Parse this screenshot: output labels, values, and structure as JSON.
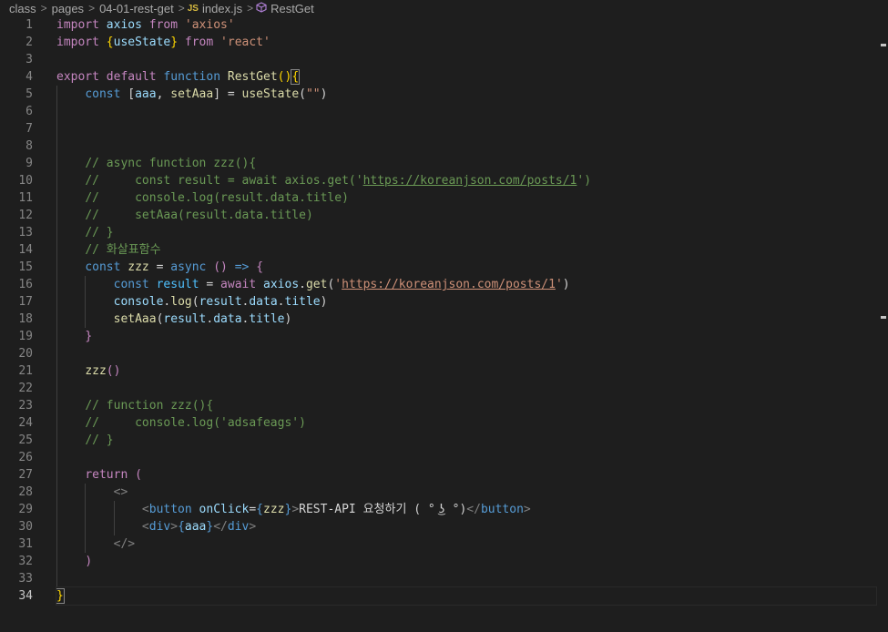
{
  "breadcrumb": {
    "items": [
      "class",
      "pages",
      "04-01-rest-get"
    ],
    "file_badge": "JS",
    "file_name": "index.js",
    "symbol": "RestGet"
  },
  "editor": {
    "current_line": 34,
    "line_numbers": [
      "1",
      "2",
      "3",
      "4",
      "5",
      "6",
      "7",
      "8",
      "9",
      "10",
      "11",
      "12",
      "13",
      "14",
      "15",
      "16",
      "17",
      "18",
      "19",
      "20",
      "21",
      "22",
      "23",
      "24",
      "25",
      "26",
      "27",
      "28",
      "29",
      "30",
      "31",
      "32",
      "33",
      "34"
    ],
    "lines": [
      [
        [
          "kw-ctl",
          "import"
        ],
        [
          "p",
          " "
        ],
        [
          "var",
          "axios"
        ],
        [
          "p",
          " "
        ],
        [
          "ctl",
          "from"
        ],
        [
          "p",
          " "
        ],
        [
          "str",
          "'axios'"
        ]
      ],
      [
        [
          "ctl",
          "import"
        ],
        [
          "p",
          " "
        ],
        [
          "brk",
          "{"
        ],
        [
          "var",
          "useState"
        ],
        [
          "brk",
          "}"
        ],
        [
          "p",
          " "
        ],
        [
          "ctl",
          "from"
        ],
        [
          "p",
          " "
        ],
        [
          "str",
          "'react'"
        ]
      ],
      [],
      [
        [
          "ctl",
          "export"
        ],
        [
          "p",
          " "
        ],
        [
          "ctl",
          "default"
        ],
        [
          "p",
          " "
        ],
        [
          "kw",
          "function"
        ],
        [
          "p",
          " "
        ],
        [
          "fn",
          "RestGet"
        ],
        [
          "brk",
          "()"
        ],
        [
          "brkhl",
          "{"
        ]
      ],
      [
        [
          "p",
          "    "
        ],
        [
          "kw",
          "const"
        ],
        [
          "p",
          " "
        ],
        [
          "plain",
          "["
        ],
        [
          "var",
          "aaa"
        ],
        [
          "plain",
          ", "
        ],
        [
          "fn",
          "setAaa"
        ],
        [
          "plain",
          "]"
        ],
        [
          "p",
          " = "
        ],
        [
          "fn",
          "useState"
        ],
        [
          "plain",
          "("
        ],
        [
          "str",
          "\"\""
        ],
        [
          "plain",
          ")"
        ]
      ],
      [],
      [],
      [],
      [
        [
          "p",
          "    "
        ],
        [
          "cm",
          "// async function zzz(){"
        ]
      ],
      [
        [
          "p",
          "    "
        ],
        [
          "cm",
          "//     const result = await axios.get('"
        ],
        [
          "cmurl",
          "https://koreanjson.com/posts/1"
        ],
        [
          "cm",
          "')"
        ]
      ],
      [
        [
          "p",
          "    "
        ],
        [
          "cm",
          "//     console.log(result.data.title)"
        ]
      ],
      [
        [
          "p",
          "    "
        ],
        [
          "cm",
          "//     setAaa(result.data.title)"
        ]
      ],
      [
        [
          "p",
          "    "
        ],
        [
          "cm",
          "// }"
        ]
      ],
      [
        [
          "p",
          "    "
        ],
        [
          "cm",
          "// 화살표함수"
        ]
      ],
      [
        [
          "p",
          "    "
        ],
        [
          "kw",
          "const"
        ],
        [
          "p",
          " "
        ],
        [
          "fn",
          "zzz"
        ],
        [
          "p",
          " = "
        ],
        [
          "kw",
          "async"
        ],
        [
          "p",
          " "
        ],
        [
          "ctl",
          "()"
        ],
        [
          "p",
          " "
        ],
        [
          "kw",
          "=>"
        ],
        [
          "p",
          " "
        ],
        [
          "ctl",
          "{"
        ]
      ],
      [
        [
          "p",
          "        "
        ],
        [
          "kw",
          "const"
        ],
        [
          "p",
          " "
        ],
        [
          "const",
          "result"
        ],
        [
          "p",
          " = "
        ],
        [
          "ctl",
          "await"
        ],
        [
          "p",
          " "
        ],
        [
          "var",
          "axios"
        ],
        [
          "plain",
          "."
        ],
        [
          "fn",
          "get"
        ],
        [
          "plain",
          "("
        ],
        [
          "str",
          "'"
        ],
        [
          "url",
          "https://koreanjson.com/posts/1"
        ],
        [
          "str",
          "'"
        ],
        [
          "plain",
          ")"
        ]
      ],
      [
        [
          "p",
          "        "
        ],
        [
          "var",
          "console"
        ],
        [
          "plain",
          "."
        ],
        [
          "fn",
          "log"
        ],
        [
          "plain",
          "("
        ],
        [
          "var",
          "result"
        ],
        [
          "plain",
          "."
        ],
        [
          "var",
          "data"
        ],
        [
          "plain",
          "."
        ],
        [
          "var",
          "title"
        ],
        [
          "plain",
          ")"
        ]
      ],
      [
        [
          "p",
          "        "
        ],
        [
          "fn",
          "setAaa"
        ],
        [
          "plain",
          "("
        ],
        [
          "var",
          "result"
        ],
        [
          "plain",
          "."
        ],
        [
          "var",
          "data"
        ],
        [
          "plain",
          "."
        ],
        [
          "var",
          "title"
        ],
        [
          "plain",
          ")"
        ]
      ],
      [
        [
          "p",
          "    "
        ],
        [
          "ctl",
          "}"
        ]
      ],
      [],
      [
        [
          "p",
          "    "
        ],
        [
          "fn",
          "zzz"
        ],
        [
          "ctl",
          "()"
        ]
      ],
      [],
      [
        [
          "p",
          "    "
        ],
        [
          "cm",
          "// function zzz(){"
        ]
      ],
      [
        [
          "p",
          "    "
        ],
        [
          "cm",
          "//     console.log('adsafeags')"
        ]
      ],
      [
        [
          "p",
          "    "
        ],
        [
          "cm",
          "// }"
        ]
      ],
      [],
      [
        [
          "p",
          "    "
        ],
        [
          "ctl",
          "return"
        ],
        [
          "p",
          " "
        ],
        [
          "ctl",
          "("
        ]
      ],
      [
        [
          "p",
          "        "
        ],
        [
          "tag",
          "<>"
        ]
      ],
      [
        [
          "p",
          "            "
        ],
        [
          "tag",
          "<"
        ],
        [
          "tagname",
          "button"
        ],
        [
          "p",
          " "
        ],
        [
          "attr",
          "onClick"
        ],
        [
          "plain",
          "="
        ],
        [
          "kw",
          "{"
        ],
        [
          "fn",
          "zzz"
        ],
        [
          "kw",
          "}"
        ],
        [
          "tag",
          ">"
        ],
        [
          "plain",
          "REST-API 요청하기 ( ° ͜ʖ °)"
        ],
        [
          "tag",
          "</"
        ],
        [
          "tagname",
          "button"
        ],
        [
          "tag",
          ">"
        ]
      ],
      [
        [
          "p",
          "            "
        ],
        [
          "tag",
          "<"
        ],
        [
          "tagname",
          "div"
        ],
        [
          "tag",
          ">"
        ],
        [
          "kw",
          "{"
        ],
        [
          "var",
          "aaa"
        ],
        [
          "kw",
          "}"
        ],
        [
          "tag",
          "</"
        ],
        [
          "tagname",
          "div"
        ],
        [
          "tag",
          ">"
        ]
      ],
      [
        [
          "p",
          "        "
        ],
        [
          "tag",
          "</>"
        ]
      ],
      [
        [
          "p",
          "    "
        ],
        [
          "ctl",
          ")"
        ]
      ],
      [],
      [
        [
          "brkhl",
          "}"
        ]
      ]
    ]
  },
  "colors": {
    "background": "#1e1e1e",
    "keyword": "#569cd6",
    "control": "#c586c0",
    "function": "#dcdcaa",
    "variable": "#9cdcfe",
    "string": "#ce9178",
    "comment": "#6a9955",
    "bracket": "#ffd700"
  }
}
